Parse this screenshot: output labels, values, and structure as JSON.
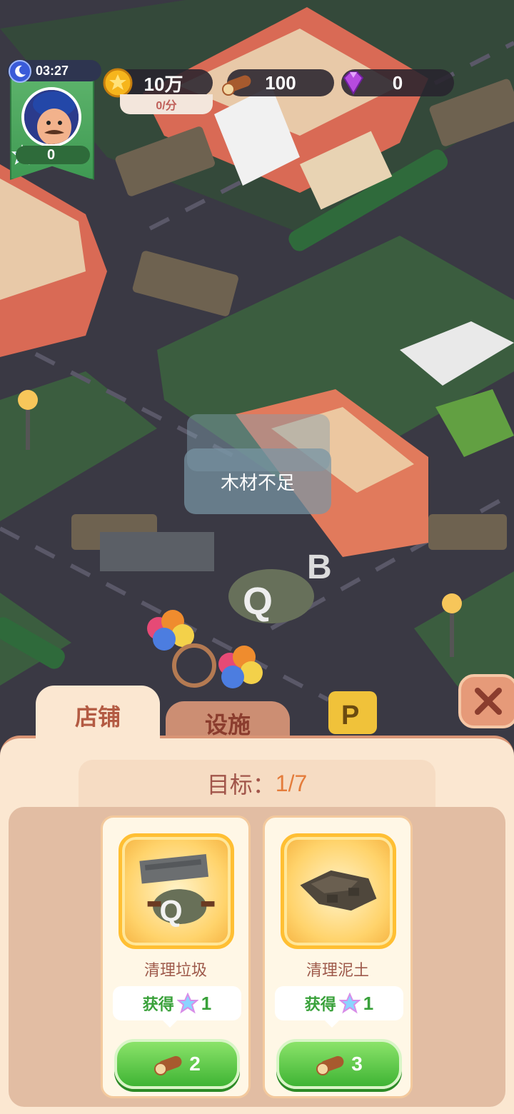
{
  "hud": {
    "timer": "03:27",
    "player_stars": "0",
    "coins": "10万",
    "coin_rate": "0/分",
    "wood": "100",
    "gems": "0"
  },
  "toast": {
    "message": "木材不足"
  },
  "tabs": [
    {
      "label": "店铺",
      "active": true
    },
    {
      "label": "设施",
      "active": false
    }
  ],
  "goal": {
    "label": "目标：",
    "value": "1/7"
  },
  "tasks": [
    {
      "title": "清理垃圾",
      "reward_label": "获得",
      "reward_value": "1",
      "cost": "2",
      "icon": "trash-debris-icon"
    },
    {
      "title": "清理泥土",
      "reward_label": "获得",
      "reward_value": "1",
      "cost": "3",
      "icon": "dirt-pile-icon"
    }
  ],
  "colors": {
    "panel_bg": "#fbe7d1",
    "accent_green": "#3fb434",
    "tab_active_text": "#b35b43",
    "goal_value": "#e47c3b"
  }
}
